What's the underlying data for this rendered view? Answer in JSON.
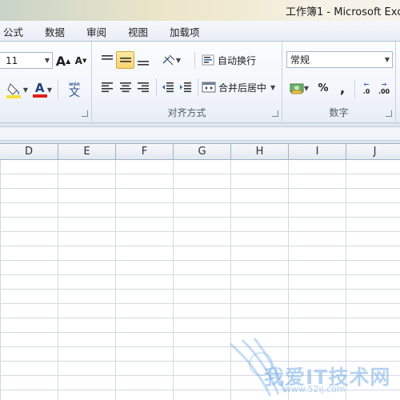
{
  "window": {
    "title": "工作簿1 - Microsoft Exce"
  },
  "tabs": [
    "公式",
    "数据",
    "审阅",
    "视图",
    "加载项"
  ],
  "font": {
    "size": "11",
    "grow_label": "A",
    "shrink_label": "A",
    "font_color_label": "A",
    "phonetic_label": "文",
    "phonetic_sub": "wén"
  },
  "alignment": {
    "wrap_text_label": "自动换行",
    "merge_center_label": "合并后居中",
    "group_label": "对齐方式",
    "vertical_align_active": "middle"
  },
  "number": {
    "format_value": "常规",
    "percent_label": "%",
    "comma_label": ",",
    "increase_decimal_label": ".0",
    "decrease_decimal_label": ".00",
    "group_label": "数字"
  },
  "columns": [
    "D",
    "E",
    "F",
    "G",
    "H",
    "I",
    "J"
  ],
  "watermark": {
    "text": "我爱IT技术网",
    "url": "www.52ij.com"
  },
  "colors": {
    "fill_bar": "#f5e03a",
    "font_bar": "#e0201b",
    "annotation": "#e8747a",
    "watermark": "#7fb2e6"
  }
}
